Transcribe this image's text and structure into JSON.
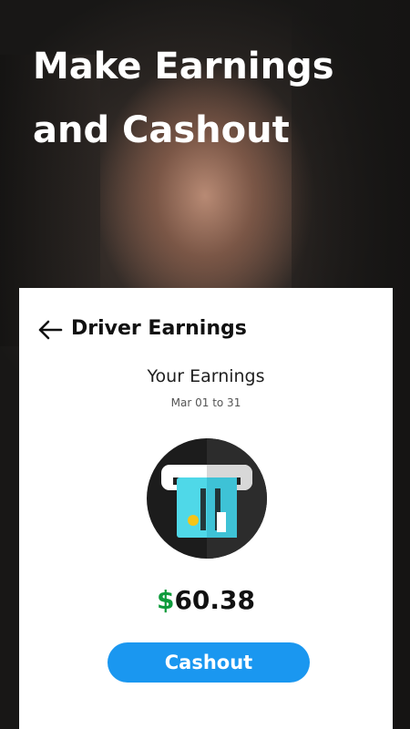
{
  "headline": {
    "line1": "Make Earnings",
    "line2": "and Cashout"
  },
  "screen": {
    "title": "Driver Earnings",
    "earnings_label": "Your Earnings",
    "date_range": "Mar 01 to 31",
    "amount_currency": "$",
    "amount_value": "60.38",
    "cashout_label": "Cashout"
  },
  "icons": {
    "back": "arrow-left-icon",
    "wallet": "card-reader-icon"
  },
  "colors": {
    "accent_button": "#1a97f0",
    "currency_green": "#0d9b3b",
    "card_teal": "#4fd8e8",
    "icon_circle": "#1c1c1c"
  }
}
